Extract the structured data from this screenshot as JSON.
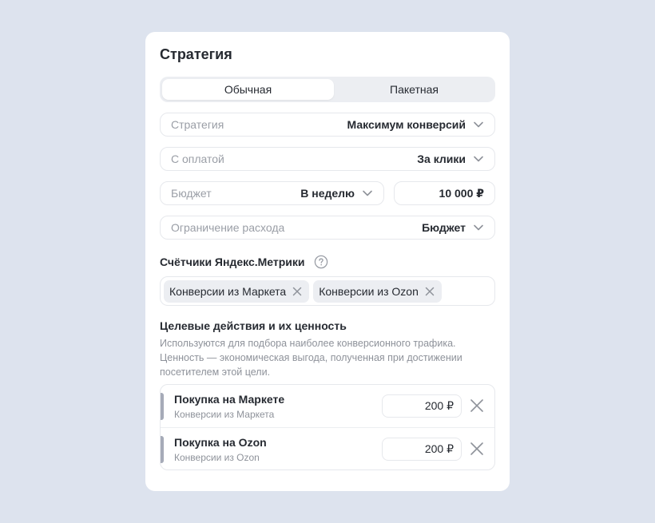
{
  "card": {
    "title": "Стратегия"
  },
  "mode_tabs": [
    {
      "label": "Обычная",
      "selected": true
    },
    {
      "label": "Пакетная",
      "selected": false
    }
  ],
  "strategy": {
    "label": "Стратегия",
    "value": "Максимум конверсий"
  },
  "payment": {
    "label": "С оплатой",
    "value": "За клики"
  },
  "budget": {
    "label": "Бюджет",
    "period": "В неделю",
    "amount": "10 000 ₽"
  },
  "limit": {
    "label": "Ограничение расхода",
    "value": "Бюджет"
  },
  "metrics": {
    "title": "Счётчики Яндекс.Метрики",
    "chips": [
      "Конверсии из Маркета",
      "Конверсии из Ozon"
    ]
  },
  "goals": {
    "title": "Целевые действия и их ценность",
    "description": "Используются для подбора наиболее конверсионного трафика. Ценность — экономическая выгода, полученная при достижении посетителем этой цели.",
    "items": [
      {
        "name": "Покупка на Маркете",
        "source": "Конверсии из Маркета",
        "value": "200 ₽"
      },
      {
        "name": "Покупка на Ozon",
        "source": "Конверсии из Ozon",
        "value": "200 ₽"
      }
    ]
  },
  "colors": {
    "background": "#dde3ee",
    "card": "#ffffff",
    "accent_bar": "#a6abb8"
  }
}
